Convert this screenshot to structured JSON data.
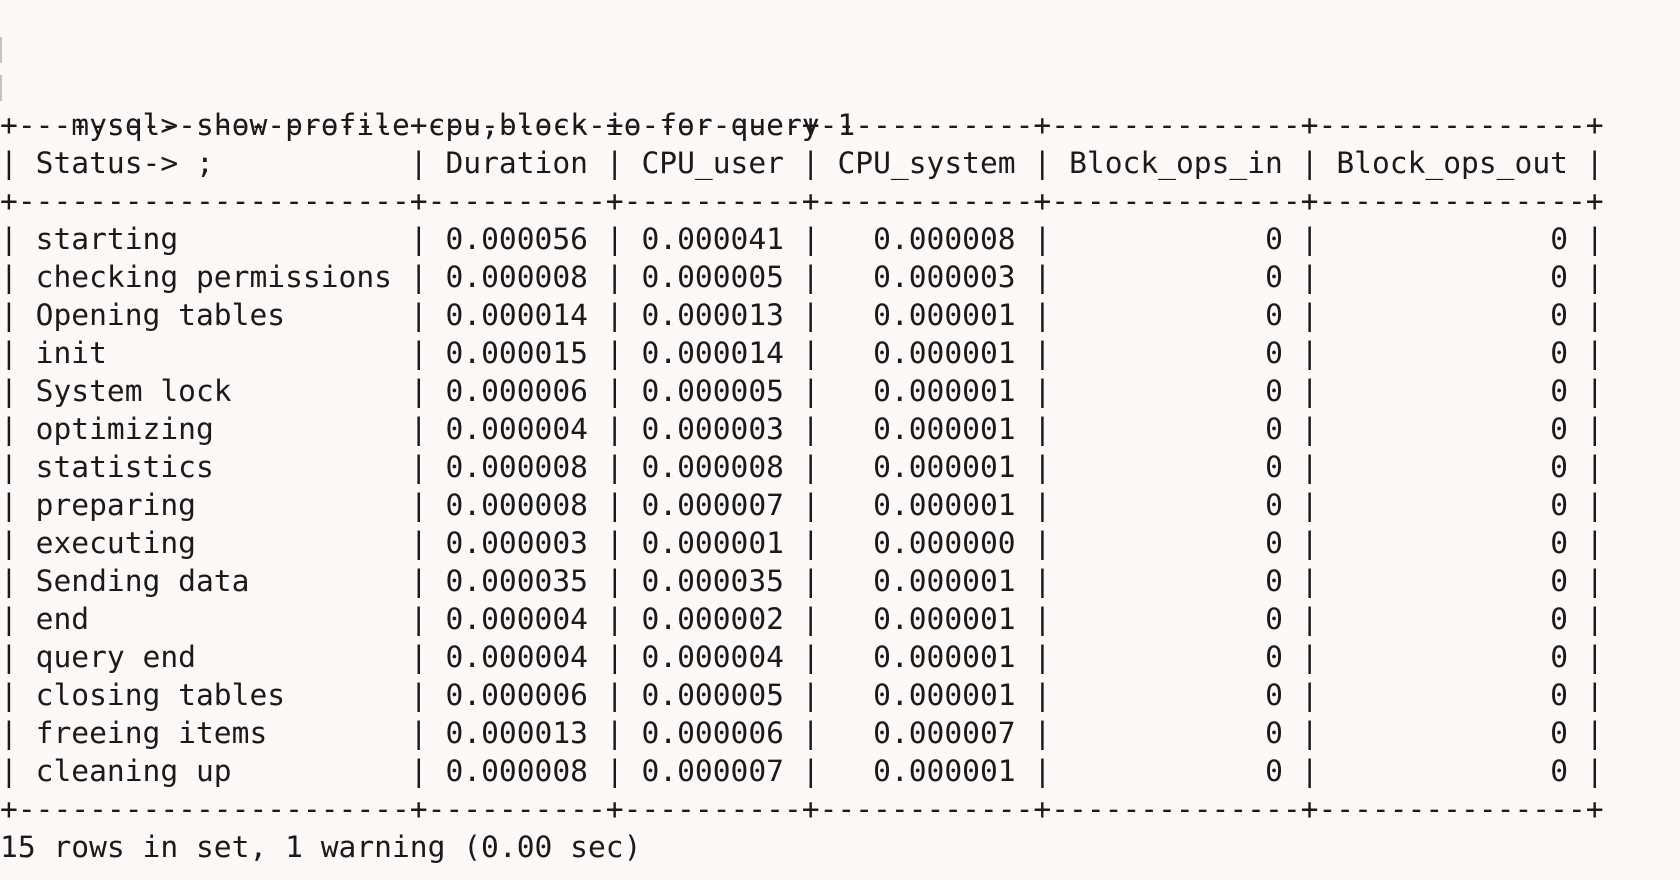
{
  "terminal": {
    "prompt": "mysql> show profile cpu,block io for query 1",
    "continuation": "    -> ;",
    "border": "+----------------------+----------+----------+------------+--------------+---------------+",
    "columns": [
      "Status",
      "Duration",
      "CPU_user",
      "CPU_system",
      "Block_ops_in",
      "Block_ops_out"
    ],
    "rows": [
      [
        "starting",
        "0.000056",
        "0.000041",
        "0.000008",
        "0",
        "0"
      ],
      [
        "checking permissions",
        "0.000008",
        "0.000005",
        "0.000003",
        "0",
        "0"
      ],
      [
        "Opening tables",
        "0.000014",
        "0.000013",
        "0.000001",
        "0",
        "0"
      ],
      [
        "init",
        "0.000015",
        "0.000014",
        "0.000001",
        "0",
        "0"
      ],
      [
        "System lock",
        "0.000006",
        "0.000005",
        "0.000001",
        "0",
        "0"
      ],
      [
        "optimizing",
        "0.000004",
        "0.000003",
        "0.000001",
        "0",
        "0"
      ],
      [
        "statistics",
        "0.000008",
        "0.000008",
        "0.000001",
        "0",
        "0"
      ],
      [
        "preparing",
        "0.000008",
        "0.000007",
        "0.000001",
        "0",
        "0"
      ],
      [
        "executing",
        "0.000003",
        "0.000001",
        "0.000000",
        "0",
        "0"
      ],
      [
        "Sending data",
        "0.000035",
        "0.000035",
        "0.000001",
        "0",
        "0"
      ],
      [
        "end",
        "0.000004",
        "0.000002",
        "0.000001",
        "0",
        "0"
      ],
      [
        "query end",
        "0.000004",
        "0.000004",
        "0.000001",
        "0",
        "0"
      ],
      [
        "closing tables",
        "0.000006",
        "0.000005",
        "0.000001",
        "0",
        "0"
      ],
      [
        "freeing items",
        "0.000013",
        "0.000006",
        "0.000007",
        "0",
        "0"
      ],
      [
        "cleaning up",
        "0.000008",
        "0.000007",
        "0.000001",
        "0",
        "0"
      ]
    ],
    "summary": "15 rows in set, 1 warning (0.00 sec)"
  }
}
